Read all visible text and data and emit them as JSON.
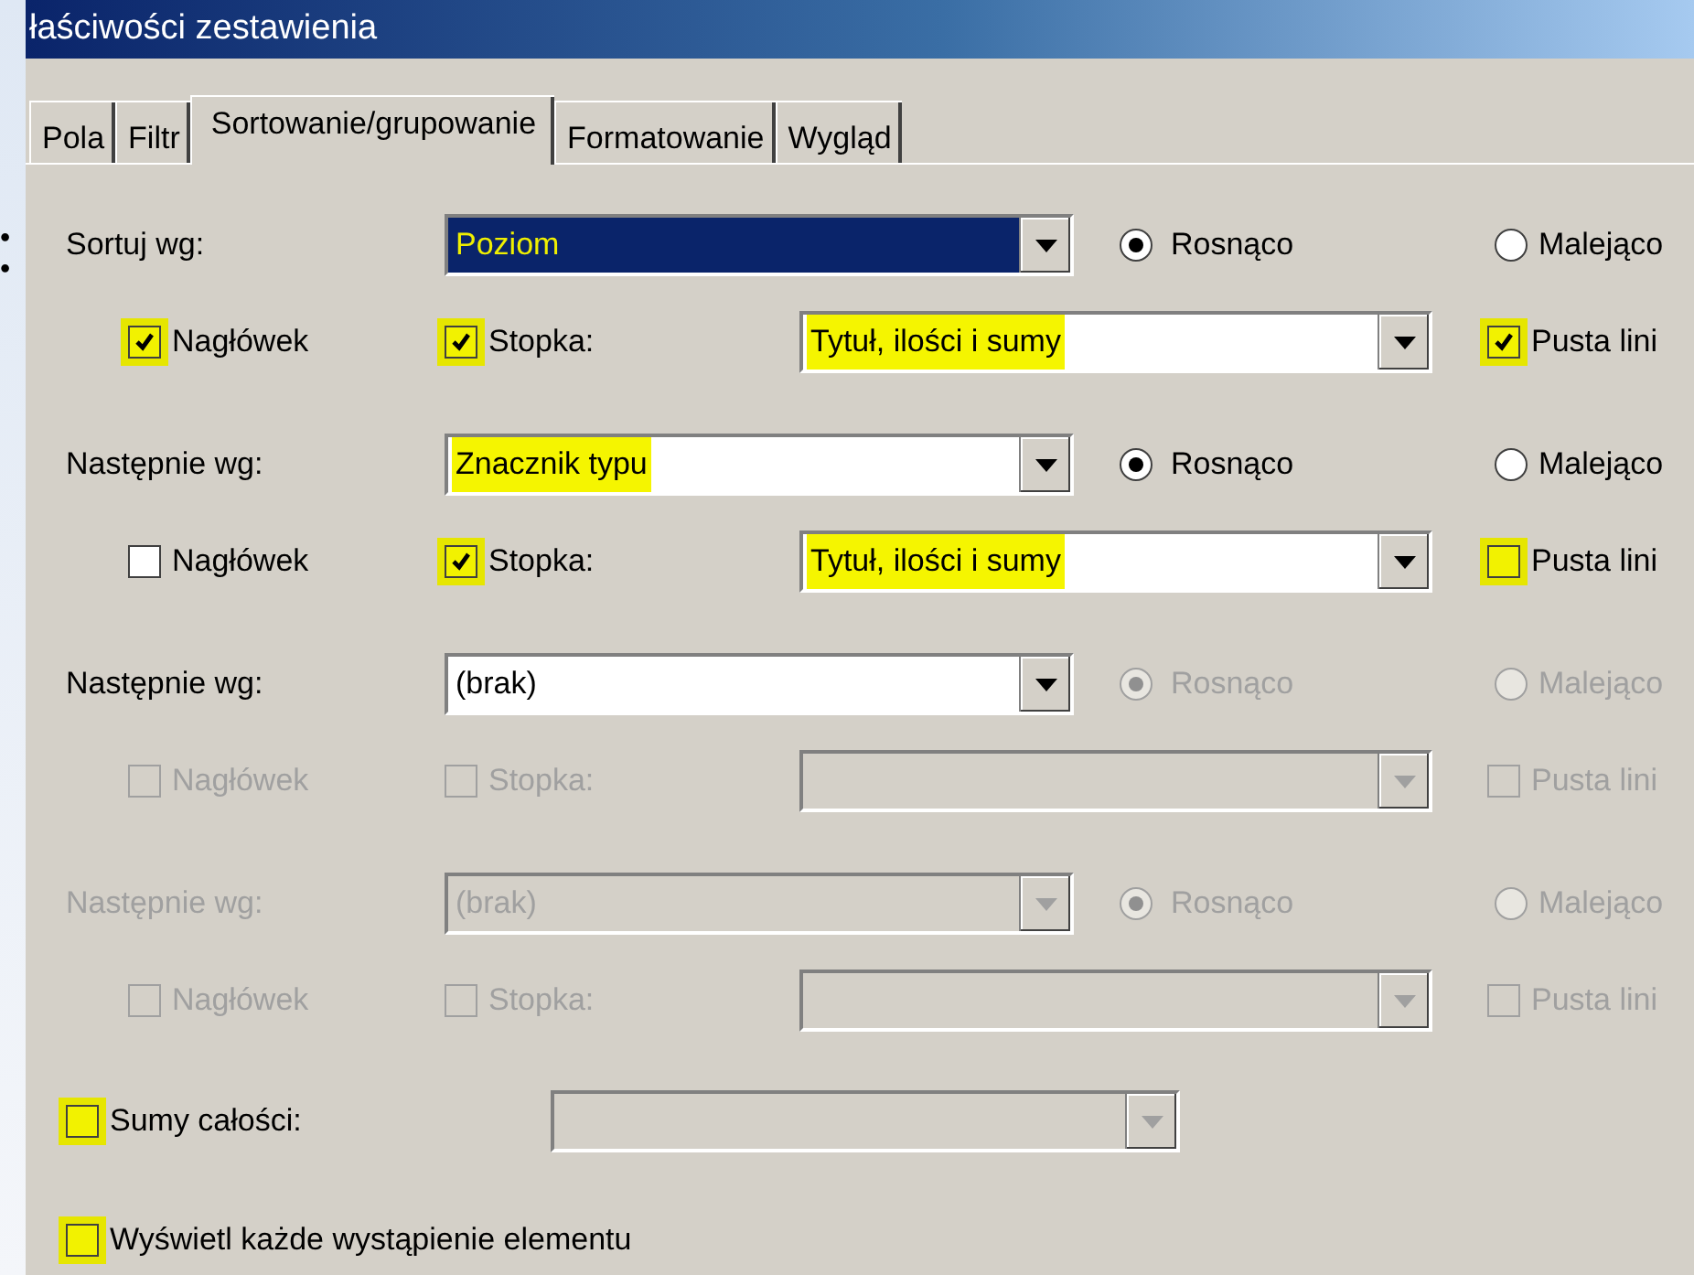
{
  "background_bullets": [
    "•",
    "•"
  ],
  "window": {
    "title": "łaściwości zestawienia"
  },
  "tabs": [
    {
      "label": "Pola",
      "selected": false
    },
    {
      "label": "Filtr",
      "selected": false
    },
    {
      "label": "Sortowanie/grupowanie",
      "selected": true
    },
    {
      "label": "Formatowanie",
      "selected": false
    },
    {
      "label": "Wygląd",
      "selected": false
    }
  ],
  "groups": [
    {
      "label": "Sortuj wg:",
      "disabled": false,
      "field": {
        "value": "Poziom",
        "focused": true,
        "highlighted": true
      },
      "ascending": {
        "label": "Rosnąco",
        "selected": true
      },
      "descending": {
        "label": "Malejąco",
        "selected": false
      },
      "options_disabled": false,
      "header": {
        "label": "Nagłówek",
        "checked": true,
        "highlighted": true
      },
      "footer": {
        "label": "Stopka:",
        "checked": true,
        "highlighted": true
      },
      "footer_mode": {
        "value": "Tytuł, ilości i sumy",
        "highlighted": true
      },
      "blank_line": {
        "label": "Pusta lini",
        "checked": true,
        "highlighted": true
      }
    },
    {
      "label": "Następnie wg:",
      "disabled": false,
      "field": {
        "value": "Znacznik typu",
        "focused": false,
        "highlighted": true
      },
      "ascending": {
        "label": "Rosnąco",
        "selected": true
      },
      "descending": {
        "label": "Malejąco",
        "selected": false
      },
      "options_disabled": false,
      "header": {
        "label": "Nagłówek",
        "checked": false,
        "highlighted": false
      },
      "footer": {
        "label": "Stopka:",
        "checked": true,
        "highlighted": true
      },
      "footer_mode": {
        "value": "Tytuł, ilości i sumy",
        "highlighted": true
      },
      "blank_line": {
        "label": "Pusta lini",
        "checked": false,
        "highlighted": true
      }
    },
    {
      "label": "Następnie wg:",
      "disabled": false,
      "field": {
        "value": "(brak)",
        "focused": false,
        "highlighted": false
      },
      "ascending": {
        "label": "Rosnąco",
        "selected": true
      },
      "descending": {
        "label": "Malejąco",
        "selected": false
      },
      "options_disabled": true,
      "header": {
        "label": "Nagłówek",
        "checked": false,
        "highlighted": false
      },
      "footer": {
        "label": "Stopka:",
        "checked": false,
        "highlighted": false
      },
      "blank_line": {
        "label": "Pusta lini",
        "checked": false,
        "highlighted": false
      }
    },
    {
      "label": "Następnie wg:",
      "disabled": true,
      "field": {
        "value": "(brak)",
        "focused": false,
        "highlighted": false
      },
      "ascending": {
        "label": "Rosnąco",
        "selected": true
      },
      "descending": {
        "label": "Malejąco",
        "selected": false
      },
      "options_disabled": true,
      "header": {
        "label": "Nagłówek",
        "checked": false,
        "highlighted": false
      },
      "footer": {
        "label": "Stopka:",
        "checked": false,
        "highlighted": false
      },
      "blank_line": {
        "label": "Pusta lini",
        "checked": false,
        "highlighted": false
      }
    }
  ],
  "totals": {
    "label": "Sumy całości:",
    "checked": false,
    "highlighted": true,
    "combo_disabled": true
  },
  "show_each": {
    "label": "Wyświetl każde wystąpienie elementu",
    "checked": false,
    "highlighted": true
  }
}
